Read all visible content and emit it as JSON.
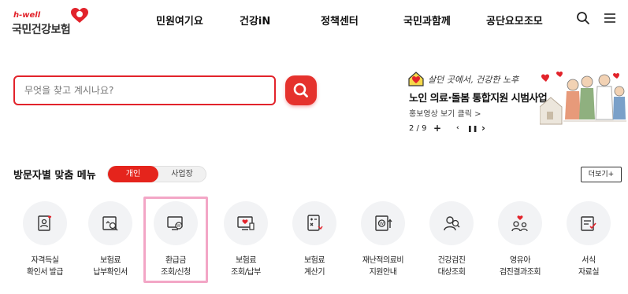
{
  "header": {
    "logo_small": "h-well",
    "logo_main": "국민건강보험",
    "nav": [
      "민원여기요",
      "건강iN",
      "정책센터",
      "국민과함께",
      "공단요모조모"
    ]
  },
  "search": {
    "placeholder": "무엇을 찾고 계시나요?"
  },
  "banner": {
    "slogan": "살던 곳에서, 건강한 노후",
    "title": "노인 의료·돌봄 통합지원 시범사업",
    "link": "홍보영상 보기 클릭 >",
    "page": "2 / 9",
    "add": "+",
    "pause": "❚❚",
    "next": "›"
  },
  "visitor_menu": {
    "title": "방문자별 맞춤 메뉴",
    "toggle_active": "개인",
    "toggle_inactive": "사업장",
    "more": "더보기+",
    "items": [
      {
        "line1": "자격득실",
        "line2": "확인서 발급",
        "icon": "qualification-certificate-icon"
      },
      {
        "line1": "보험료",
        "line2": "납부확인서",
        "icon": "payment-confirmation-icon"
      },
      {
        "line1": "환급금",
        "line2": "조회/신청",
        "icon": "refund-icon"
      },
      {
        "line1": "보험료",
        "line2": "조회/납부",
        "icon": "premium-payment-icon"
      },
      {
        "line1": "보험료",
        "line2": "계산기",
        "icon": "calculator-icon"
      },
      {
        "line1": "재난적의료비",
        "line2": "지원안내",
        "icon": "medical-support-icon"
      },
      {
        "line1": "건강검진",
        "line2": "대상조회",
        "icon": "health-checkup-icon"
      },
      {
        "line1": "영유아",
        "line2": "검진결과조회",
        "icon": "infant-checkup-icon"
      },
      {
        "line1": "서식",
        "line2": "자료실",
        "icon": "forms-icon"
      }
    ]
  },
  "colors": {
    "brand_red": "#e2232b",
    "highlight": "#f3a6c6"
  }
}
